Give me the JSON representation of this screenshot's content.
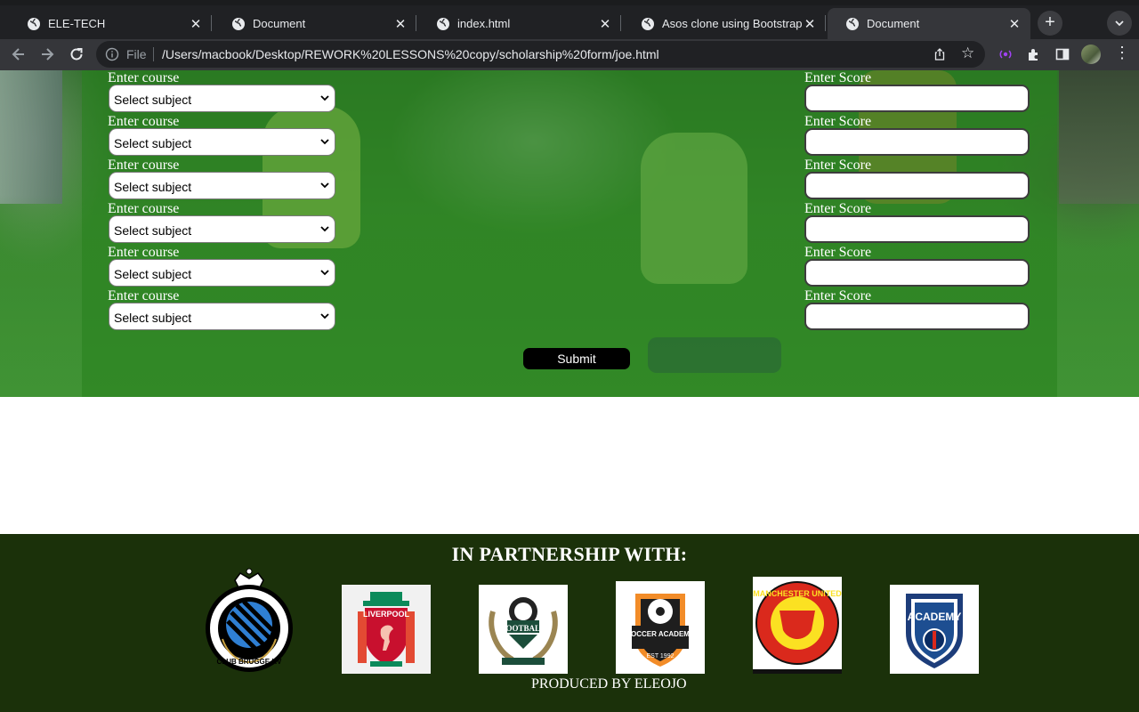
{
  "browser": {
    "tabs": [
      {
        "title": "ELE-TECH",
        "active": false
      },
      {
        "title": "Document",
        "active": false
      },
      {
        "title": "index.html",
        "active": false
      },
      {
        "title": "Asos clone using Bootstrap",
        "active": false
      },
      {
        "title": "Document",
        "active": true
      }
    ],
    "close_glyph": "✕",
    "new_tab_glyph": "+",
    "address": {
      "scheme_label": "File",
      "url": "/Users/macbook/Desktop/REWORK%20LESSONS%20copy/scholarship%20form/joe.html"
    }
  },
  "form": {
    "course_label": "Enter course",
    "score_label": "Enter Score",
    "rows": [
      {
        "course_selected": "Select subject",
        "score_value": ""
      },
      {
        "course_selected": "Select subject",
        "score_value": ""
      },
      {
        "course_selected": "Select subject",
        "score_value": ""
      },
      {
        "course_selected": "Select subject",
        "score_value": ""
      },
      {
        "course_selected": "Select subject",
        "score_value": ""
      },
      {
        "course_selected": "Select subject",
        "score_value": ""
      }
    ],
    "submit_label": "Submit"
  },
  "footer": {
    "title": "IN PARTNERSHIP WITH:",
    "logos": [
      {
        "name": "club-brugge-logo",
        "text": "CLUB BRUGGE KV"
      },
      {
        "name": "liverpool-logo",
        "text": "LIVERPOOL"
      },
      {
        "name": "diamond-football-academy-logo",
        "text": "FOOTBALL"
      },
      {
        "name": "soccer-academy-logo",
        "text": "SOCCER ACADEMY"
      },
      {
        "name": "manchester-united-logo",
        "text": "MANCHESTER UNITED"
      },
      {
        "name": "psg-academy-logo",
        "text": "ACADEMY"
      }
    ],
    "credit": "PRODUCED BY ELEOJO"
  },
  "colors": {
    "overlay": "#2a7f1e",
    "footer_bg": "#1b310a",
    "submit_bg": "#000000"
  }
}
